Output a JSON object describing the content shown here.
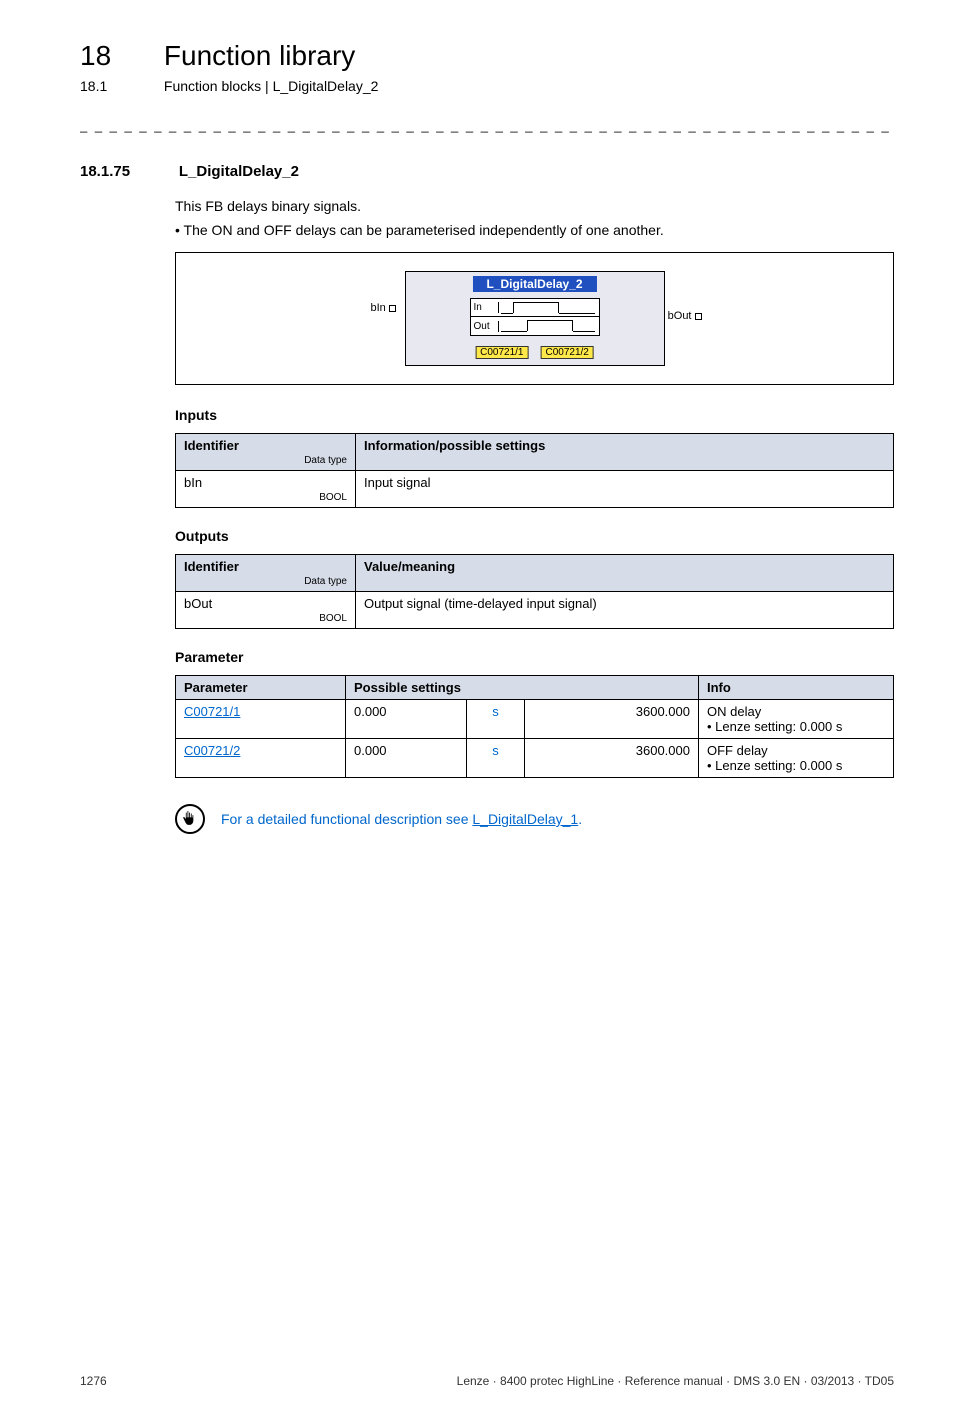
{
  "chapter": {
    "num": "18",
    "title": "Function library"
  },
  "subsection": {
    "num": "18.1",
    "title": "Function blocks | L_DigitalDelay_2"
  },
  "dashline": "_ _ _ _ _ _ _ _ _ _ _ _ _ _ _ _ _ _ _ _ _ _ _ _ _ _ _ _ _ _ _ _ _ _ _ _ _ _ _ _ _ _ _ _ _ _ _ _ _ _ _ _ _ _ _ _ _ _ _ _ _ _ _ _",
  "section": {
    "num": "18.1.75",
    "title": "L_DigitalDelay_2"
  },
  "intro": "This FB delays binary signals.",
  "bullet1": "The ON and OFF delays can be parameterised independently of one another.",
  "fb": {
    "title": "L_DigitalDelay_2",
    "pin_in": "bIn",
    "pin_out": "bOut",
    "row_in": "In",
    "row_out": "Out",
    "code1": "C00721/1",
    "code2": "C00721/2"
  },
  "headings": {
    "inputs": "Inputs",
    "outputs": "Outputs",
    "parameter": "Parameter"
  },
  "inputs_table": {
    "h_identifier": "Identifier",
    "h_datatype": "Data type",
    "h_info": "Information/possible settings",
    "row": {
      "id": "bIn",
      "dtype": "BOOL",
      "info": "Input signal"
    }
  },
  "outputs_table": {
    "h_identifier": "Identifier",
    "h_datatype": "Data type",
    "h_info": "Value/meaning",
    "row": {
      "id": "bOut",
      "dtype": "BOOL",
      "info": "Output signal (time-delayed input signal)"
    }
  },
  "param_table": {
    "h_param": "Parameter",
    "h_possible": "Possible settings",
    "h_info": "Info",
    "rows": [
      {
        "param": "C00721/1",
        "min": "0.000",
        "unit": "s",
        "max": "3600.000",
        "info_title": "ON delay",
        "info_detail": "• Lenze setting: 0.000 s"
      },
      {
        "param": "C00721/2",
        "min": "0.000",
        "unit": "s",
        "max": "3600.000",
        "info_title": "OFF delay",
        "info_detail": "• Lenze setting: 0.000 s"
      }
    ]
  },
  "tip": {
    "text_prefix": "For a detailed functional description see ",
    "link": "L_DigitalDelay_1",
    "text_suffix": "."
  },
  "footer": {
    "page": "1276",
    "meta": "Lenze · 8400 protec HighLine · Reference manual · DMS 3.0 EN · 03/2013 · TD05"
  }
}
